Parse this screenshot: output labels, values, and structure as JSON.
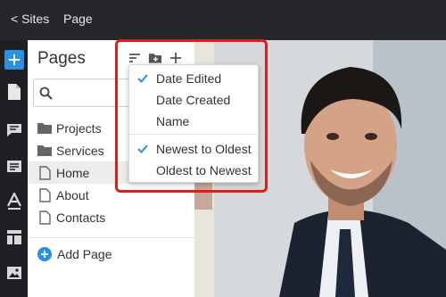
{
  "topbar": {
    "sites_link": "< Sites",
    "page_link": "Page"
  },
  "rail": {
    "icons": [
      "plus-icon",
      "page-icon",
      "comment-icon",
      "text-block-icon",
      "font-icon",
      "layout-icon",
      "image-icon"
    ],
    "accent": "#2d8fe0"
  },
  "panel": {
    "title": "Pages",
    "search_placeholder": "",
    "items": [
      {
        "label": "Projects",
        "type": "folder",
        "selected": false
      },
      {
        "label": "Services",
        "type": "folder",
        "selected": false
      },
      {
        "label": "Home",
        "type": "page",
        "selected": true
      },
      {
        "label": "About",
        "type": "page",
        "selected": false
      },
      {
        "label": "Contacts",
        "type": "page",
        "selected": false
      }
    ],
    "add_page_label": "Add Page"
  },
  "sort_menu": {
    "sort_by": [
      {
        "label": "Date Edited",
        "checked": true
      },
      {
        "label": "Date Created",
        "checked": false
      },
      {
        "label": "Name",
        "checked": false
      }
    ],
    "order": [
      {
        "label": "Newest to Oldest",
        "checked": true
      },
      {
        "label": "Oldest to Newest",
        "checked": false
      }
    ]
  },
  "colors": {
    "highlight": "#e01b1b",
    "check": "#2d8fe0",
    "selected_row": "#ececec"
  }
}
